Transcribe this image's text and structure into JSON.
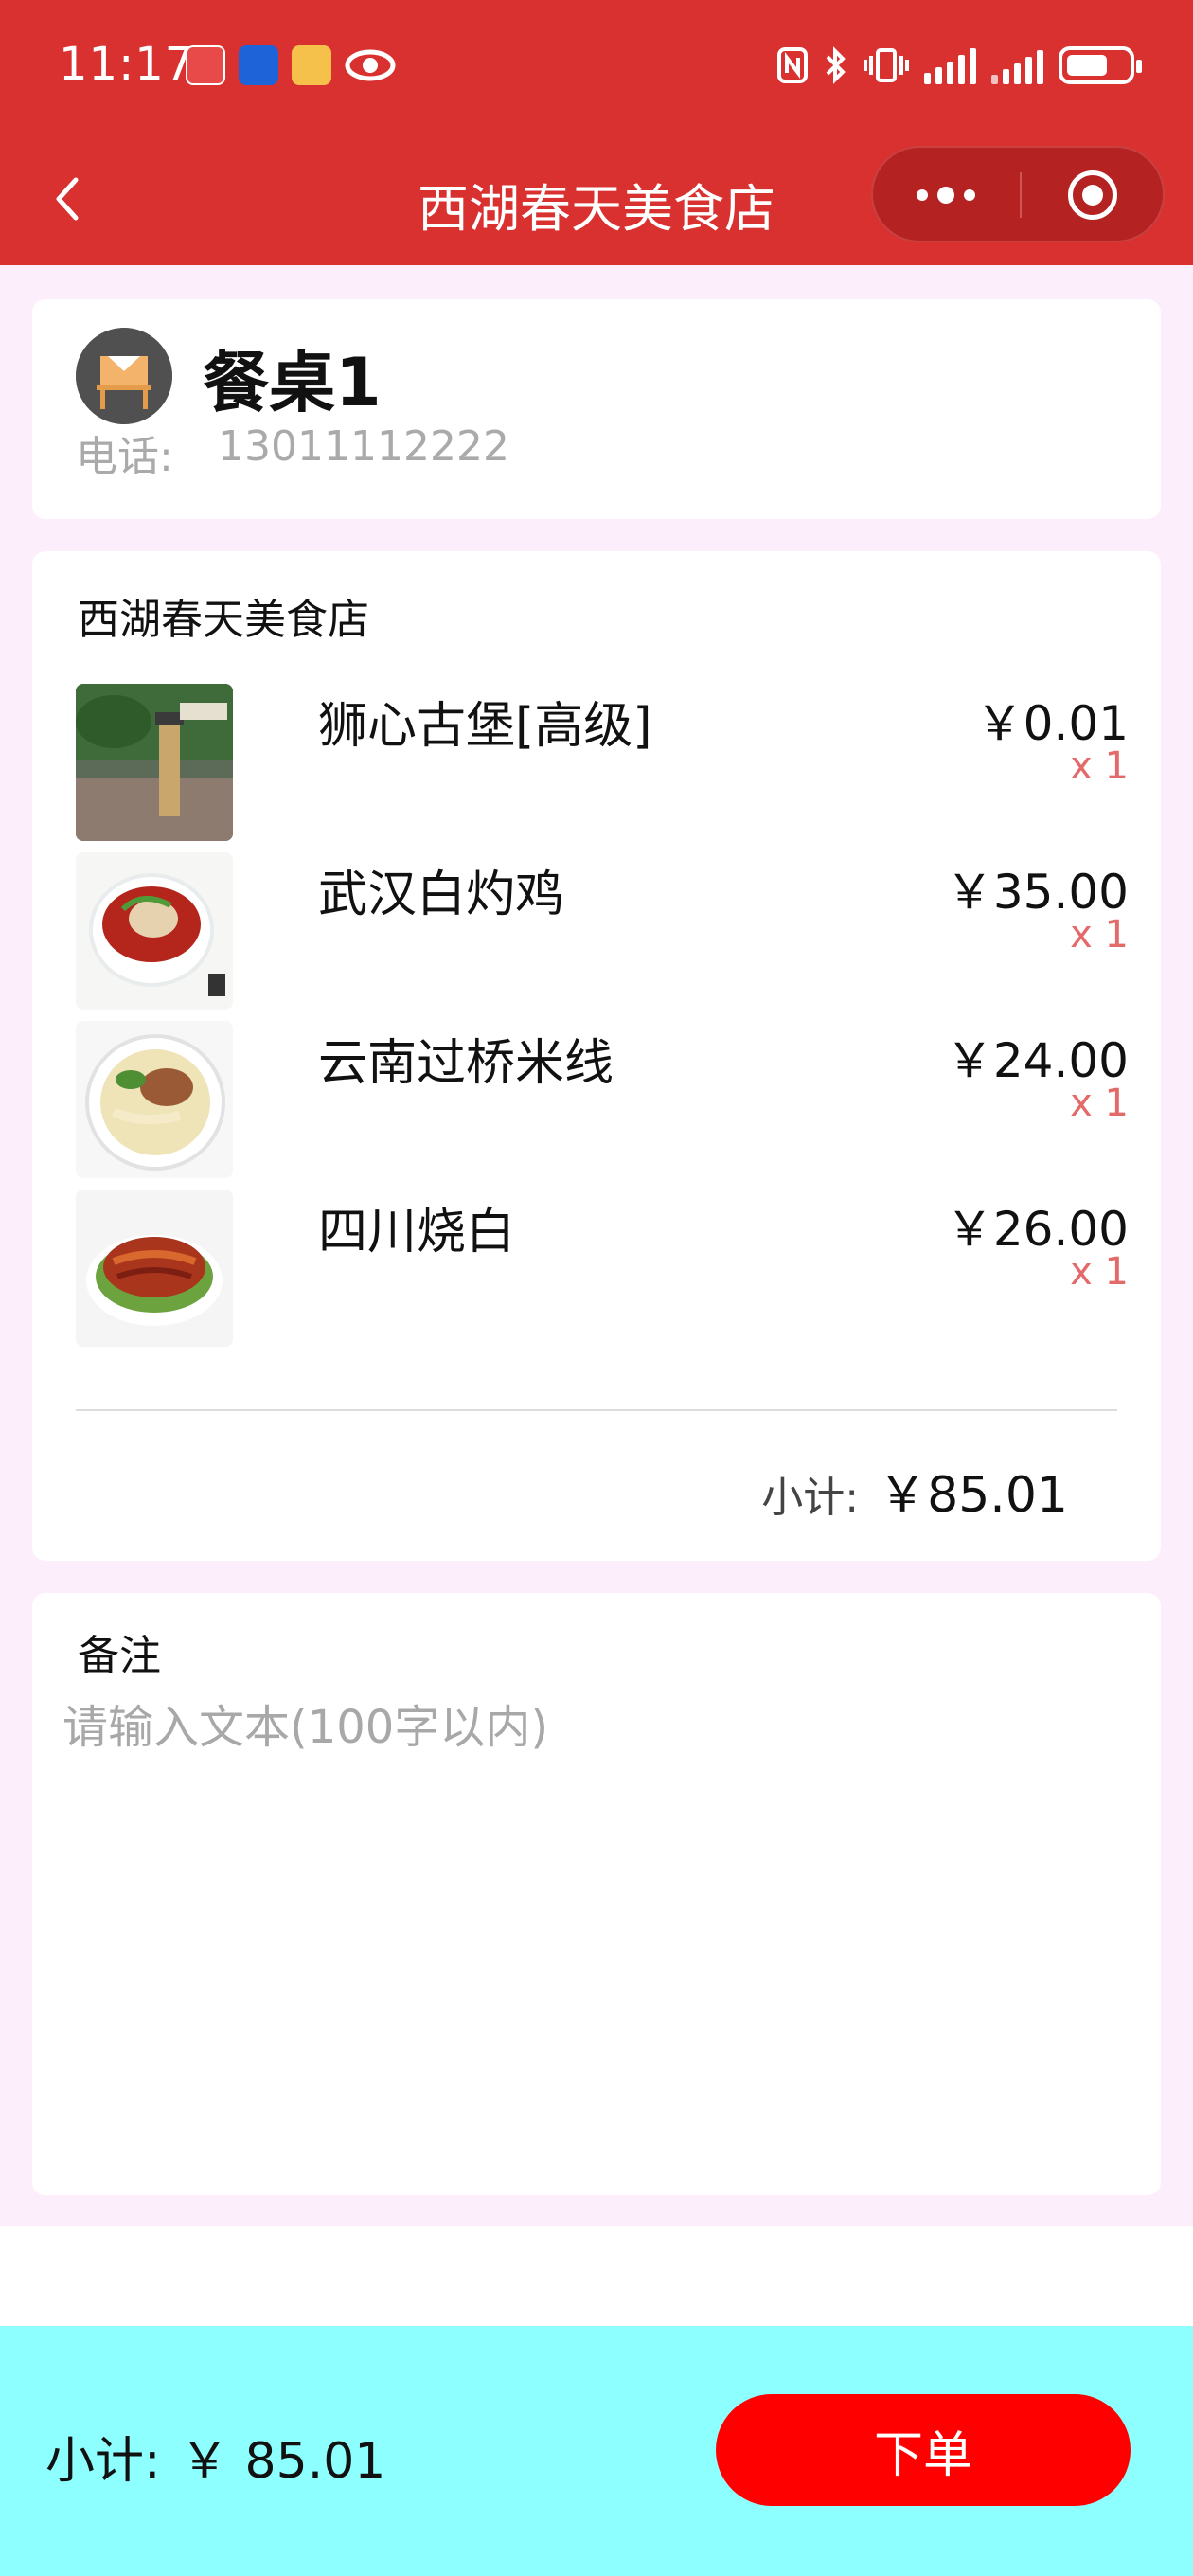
{
  "status_bar": {
    "time": "11:17"
  },
  "nav": {
    "title": "西湖春天美食店"
  },
  "table": {
    "name": "餐桌1",
    "phone_label": "电话:",
    "phone": "13011112222"
  },
  "order": {
    "store_name": "西湖春天美食店",
    "items": [
      {
        "name": "狮心古堡[高级]",
        "price": "￥0.01",
        "qty": "x 1"
      },
      {
        "name": "武汉白灼鸡",
        "price": "￥35.00",
        "qty": "x 1"
      },
      {
        "name": "云南过桥米线",
        "price": "￥24.00",
        "qty": "x 1"
      },
      {
        "name": "四川烧白",
        "price": "￥26.00",
        "qty": "x 1"
      }
    ],
    "subtotal_label": "小计:",
    "subtotal_value": "￥85.01"
  },
  "note": {
    "label": "备注",
    "placeholder": "请输入文本(100字以内)"
  },
  "footer": {
    "total_label": "小计:",
    "total_value": "￥ 85.01",
    "submit_label": "下单"
  },
  "colors": {
    "header": "#d93030",
    "page_bg": "#fdeefc",
    "footer_bg": "#8effff",
    "submit": "#ff0000",
    "qty": "#e46a6a"
  }
}
